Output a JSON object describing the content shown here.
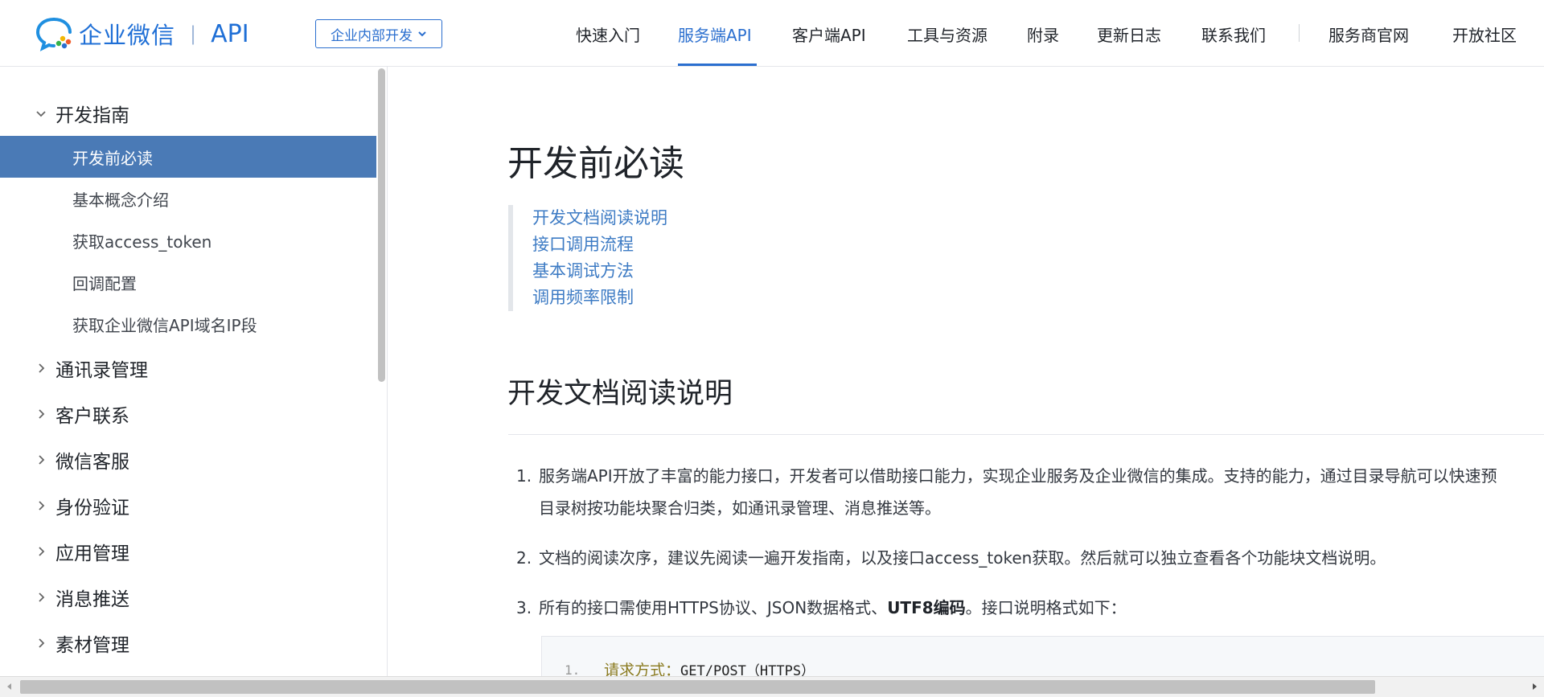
{
  "header": {
    "logo_text": "企业微信",
    "logo_sep": "|",
    "logo_api": "API",
    "dev_select": "企业内部开发",
    "nav": [
      {
        "label": "快速入门"
      },
      {
        "label": "服务端API",
        "active": true
      },
      {
        "label": "客户端API"
      },
      {
        "label": "工具与资源"
      },
      {
        "label": "附录"
      },
      {
        "label": "更新日志"
      },
      {
        "label": "联系我们"
      },
      {
        "label": "服务商官网"
      },
      {
        "label": "开放社区"
      }
    ]
  },
  "sidebar": {
    "expanded_group": "开发指南",
    "sub_items": [
      {
        "label": "开发前必读",
        "active": true
      },
      {
        "label": "基本概念介绍"
      },
      {
        "label": "获取access_token"
      },
      {
        "label": "回调配置"
      },
      {
        "label": "获取企业微信API域名IP段"
      }
    ],
    "groups": [
      "通讯录管理",
      "客户联系",
      "微信客服",
      "身份验证",
      "应用管理",
      "消息推送",
      "素材管理"
    ]
  },
  "main": {
    "title": "开发前必读",
    "toc": [
      "开发文档阅读说明",
      "接口调用流程",
      "基本调试方法",
      "调用频率限制"
    ],
    "section_title": "开发文档阅读说明",
    "items": [
      {
        "num": "1.",
        "line1": "服务端API开放了丰富的能力接口，开发者可以借助接口能力，实现企业服务及企业微信的集成。支持的能力，通过目录导航可以快速预",
        "line2": "目录树按功能块聚合归类，如通讯录管理、消息推送等。"
      },
      {
        "num": "2.",
        "line1": "文档的阅读次序，建议先阅读一遍开发指南，以及接口access_token获取。然后就可以独立查看各个功能块文档说明。"
      },
      {
        "num": "3.",
        "pre": "所有的接口需使用HTTPS协议、JSON数据格式、",
        "bold": "UTF8编码",
        "post": "。接口说明格式如下："
      }
    ],
    "code": {
      "line_no": "1.",
      "key": "请求方式：",
      "value": "GET/POST（HTTPS）"
    }
  },
  "colors": {
    "accent": "#2b6fcf",
    "sidebar_active": "#4a7ab6",
    "link": "#3d7bc4"
  }
}
